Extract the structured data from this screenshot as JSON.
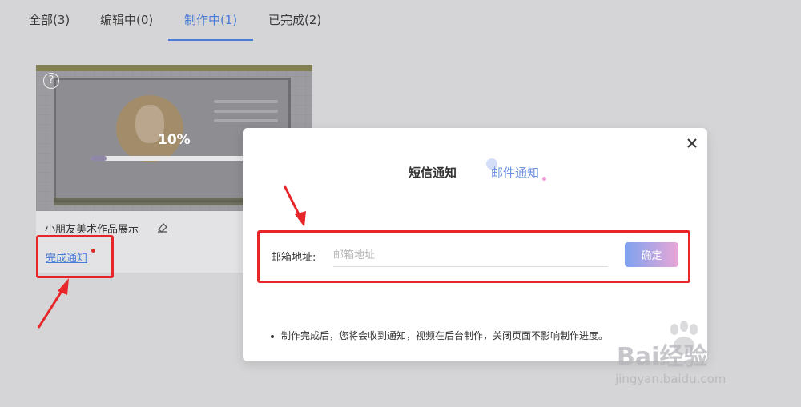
{
  "tabs": [
    {
      "label": "全部(3)"
    },
    {
      "label": "编辑中(0)"
    },
    {
      "label": "制作中(1)"
    },
    {
      "label": "已完成(2)"
    }
  ],
  "active_tab_index": 2,
  "card": {
    "progress_text": "10%",
    "progress_value": 0.1,
    "title": "小朋友美术作品展示",
    "notify_link": "完成通知",
    "help_icon": "question-circle-icon",
    "edit_icon": "eraser-edit-icon"
  },
  "modal": {
    "tab_sms": "短信通知",
    "tab_email": "邮件通知",
    "field_label": "邮箱地址:",
    "email_placeholder": "邮箱地址",
    "email_value": "",
    "confirm_label": "确定",
    "note": "制作完成后，您将会收到通知，视频在后台制作，关闭页面不影响制作进度。",
    "close_icon": "close-icon"
  },
  "watermark": {
    "brand": "Bai经验",
    "url": "jingyan.baidu.com"
  },
  "colors": {
    "accent": "#4a7bd6",
    "annotation_red": "#e8262a",
    "background": "#d5d5d7"
  }
}
